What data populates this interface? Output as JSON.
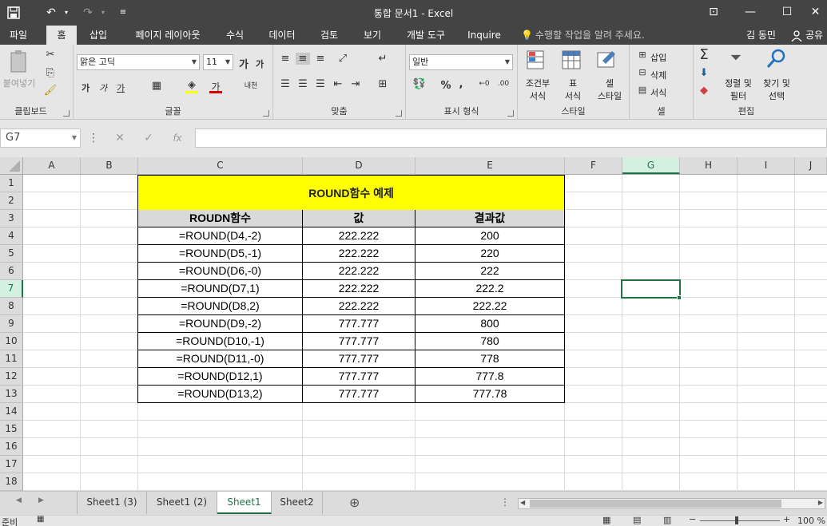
{
  "window": {
    "title": "통합 문서1 - Excel",
    "quick_access": {
      "save_icon": "save-icon",
      "undo_icon": "undo-icon",
      "redo_icon": "redo-icon",
      "customize_icon": "customize-icon"
    },
    "controls": {
      "ribbon_display": "⊡",
      "minimize": "—",
      "maximize": "☐",
      "close": "✕"
    }
  },
  "tabs": [
    {
      "label": "파일"
    },
    {
      "label": "홈",
      "active": true
    },
    {
      "label": "삽입"
    },
    {
      "label": "페이지 레이아웃"
    },
    {
      "label": "수식"
    },
    {
      "label": "데이터"
    },
    {
      "label": "검토"
    },
    {
      "label": "보기"
    },
    {
      "label": "개발 도구"
    },
    {
      "label": "Inquire"
    }
  ],
  "tell_me": "수행할 작업을 알려 주세요.",
  "user": "김 동민",
  "share": "공유",
  "ribbon": {
    "clipboard": {
      "label": "클립보드",
      "paste": "붙여넣기"
    },
    "font": {
      "label": "글꼴",
      "font_name": "맑은 고딕",
      "font_size": "11",
      "bold": "가",
      "italic": "가",
      "underline": "가",
      "font_color": "가",
      "phonetic": "내천"
    },
    "alignment": {
      "label": "맞춤"
    },
    "number": {
      "label": "표시 형식",
      "format": "일반",
      "percent": "%",
      "comma": ","
    },
    "styles": {
      "label": "스타일",
      "conditional": [
        "조건부",
        "서식"
      ],
      "table": [
        "표",
        "서식"
      ],
      "cell_styles": [
        "셀",
        "스타일"
      ]
    },
    "cells": {
      "label": "셀",
      "insert": "삽입",
      "delete": "삭제",
      "format": "서식"
    },
    "editing": {
      "label": "편집",
      "sort_filter": [
        "정렬 및",
        "필터"
      ],
      "find_select": [
        "찾기 및",
        "선택"
      ]
    }
  },
  "formula_bar": {
    "name_box": "G7",
    "fx": "fx",
    "formula": ""
  },
  "columns": [
    "A",
    "B",
    "C",
    "D",
    "E",
    "F",
    "G",
    "H",
    "I",
    "J"
  ],
  "selected_column": "G",
  "rows": [
    "1",
    "2",
    "3",
    "4",
    "5",
    "6",
    "7",
    "8",
    "9",
    "10",
    "11",
    "12",
    "13",
    "14",
    "15",
    "16",
    "17",
    "18"
  ],
  "selected_row": "7",
  "sheet": {
    "title": "ROUND함수 예제",
    "headers": [
      "ROUDN함수",
      "값",
      "결과값"
    ],
    "data": [
      [
        "=ROUND(D4,-2)",
        "222.222",
        "200"
      ],
      [
        "=ROUND(D5,-1)",
        "222.222",
        "220"
      ],
      [
        "=ROUND(D6,-0)",
        "222.222",
        "222"
      ],
      [
        "=ROUND(D7,1)",
        "222.222",
        "222.2"
      ],
      [
        "=ROUND(D8,2)",
        "222.222",
        "222.22"
      ],
      [
        "=ROUND(D9,-2)",
        "777.777",
        "800"
      ],
      [
        "=ROUND(D10,-1)",
        "777.777",
        "780"
      ],
      [
        "=ROUND(D11,-0)",
        "777.777",
        "778"
      ],
      [
        "=ROUND(D12,1)",
        "777.777",
        "777.8"
      ],
      [
        "=ROUND(D13,2)",
        "777.777",
        "777.78"
      ]
    ]
  },
  "sheet_tabs": [
    {
      "label": "Sheet1 (3)"
    },
    {
      "label": "Sheet1 (2)"
    },
    {
      "label": "Sheet1",
      "active": true
    },
    {
      "label": "Sheet2"
    }
  ],
  "status": {
    "ready": "준비",
    "zoom": "100 %"
  },
  "colors": {
    "accent": "#217346",
    "title_bg": "#ffff00",
    "header_bg": "#d9d9d9",
    "chrome": "#444444"
  }
}
